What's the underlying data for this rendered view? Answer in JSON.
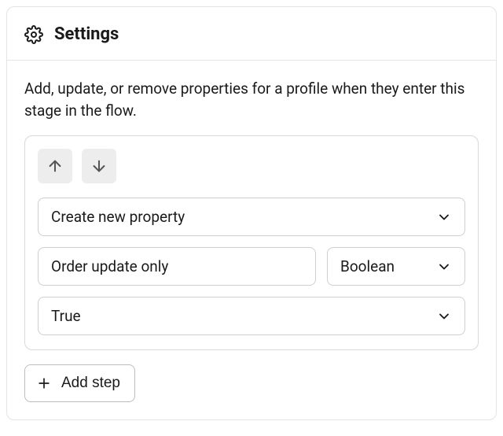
{
  "header": {
    "title": "Settings"
  },
  "description": "Add, update, or remove properties for a profile when they enter this stage in the flow.",
  "step": {
    "action": "Create new property",
    "property_name": "Order update only",
    "type": "Boolean",
    "value": "True"
  },
  "buttons": {
    "add_step": "Add step"
  }
}
